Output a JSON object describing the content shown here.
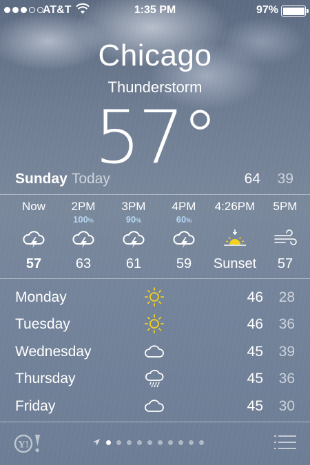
{
  "status_bar": {
    "carrier": "AT&T",
    "time": "1:35 PM",
    "battery": "97%"
  },
  "location": {
    "city": "Chicago",
    "condition": "Thunderstorm",
    "temperature": "57",
    "degree": "°"
  },
  "today": {
    "day": "Sunday",
    "label": "Today",
    "high": "64",
    "low": "39"
  },
  "hourly": [
    {
      "time": "Now",
      "icon": "thunderstorm-icon",
      "precip": "",
      "value": "57"
    },
    {
      "time": "2PM",
      "icon": "thunderstorm-icon",
      "precip": "100",
      "value": "63"
    },
    {
      "time": "3PM",
      "icon": "thunderstorm-icon",
      "precip": "90",
      "value": "61"
    },
    {
      "time": "4PM",
      "icon": "thunderstorm-icon",
      "precip": "60",
      "value": "59"
    },
    {
      "time": "4:26PM",
      "icon": "sunset-icon",
      "precip": "",
      "value": "Sunset"
    },
    {
      "time": "5PM",
      "icon": "wind-icon",
      "precip": "",
      "value": "57"
    }
  ],
  "percent_sign": "%",
  "daily": [
    {
      "day": "Monday",
      "icon": "sun-icon",
      "high": "46",
      "low": "28"
    },
    {
      "day": "Tuesday",
      "icon": "sun-icon",
      "high": "46",
      "low": "36"
    },
    {
      "day": "Wednesday",
      "icon": "cloud-icon",
      "high": "45",
      "low": "39"
    },
    {
      "day": "Thursday",
      "icon": "rain-icon",
      "high": "45",
      "low": "36"
    },
    {
      "day": "Friday",
      "icon": "cloud-icon",
      "high": "45",
      "low": "30"
    }
  ],
  "footer": {
    "logo": "Y!",
    "page_count": 10,
    "active_page": 1
  },
  "colors": {
    "precip_text": "#b7d8f2",
    "sun_yellow": "#f2d21c",
    "faded_text": "rgba(255,255,255,0.65)"
  }
}
